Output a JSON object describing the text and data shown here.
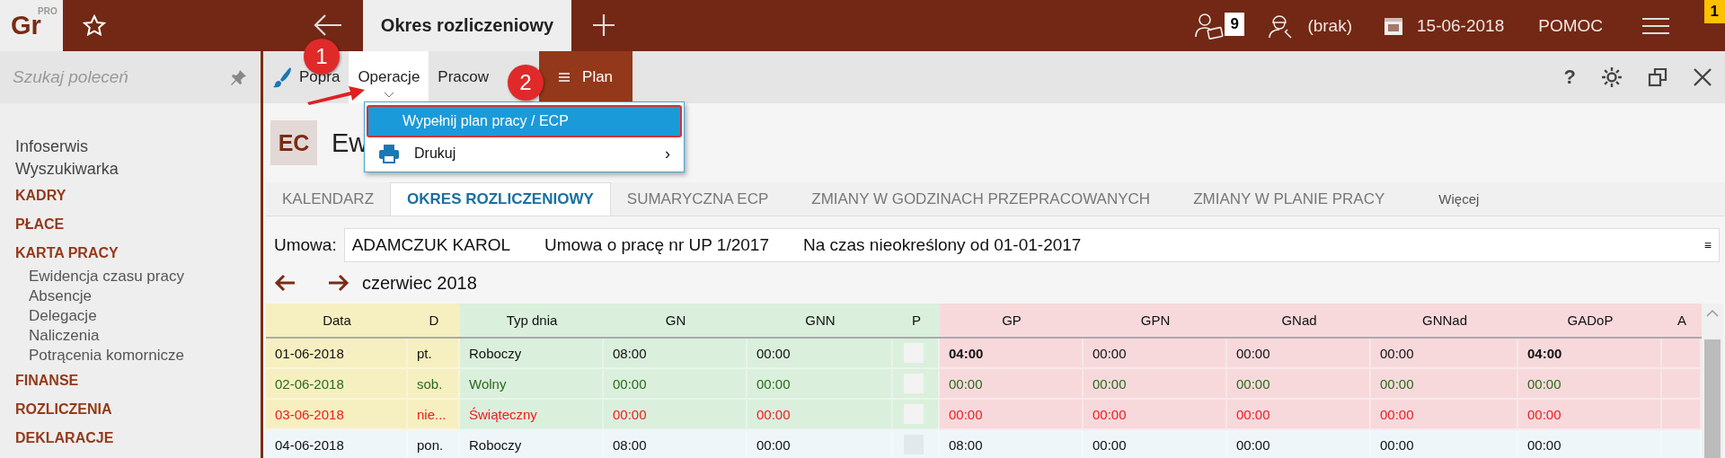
{
  "app_bar": {
    "logo": "Gr",
    "logo_badge": "PRO",
    "tab": "Okres rozliczeniowy",
    "notifications_badge": "9",
    "user": "(brak)",
    "date": "15-06-2018",
    "help": "POMOC",
    "menu_badge": "1"
  },
  "sidebar": {
    "search_placeholder": "Szukaj poleceń",
    "items": [
      {
        "label": "Infoserwis",
        "kind": "link"
      },
      {
        "label": "Wyszukiwarka",
        "kind": "link"
      },
      {
        "label": "KADRY",
        "kind": "section"
      },
      {
        "label": "PŁACE",
        "kind": "section"
      },
      {
        "label": "KARTA PRACY",
        "kind": "section",
        "children": [
          {
            "label": "Ewidencja czasu pracy"
          },
          {
            "label": "Absencje"
          },
          {
            "label": "Delegacje"
          },
          {
            "label": "Naliczenia"
          },
          {
            "label": "Potrącenia komornicze"
          }
        ]
      },
      {
        "label": "FINANSE",
        "kind": "section"
      },
      {
        "label": "ROZLICZENIA",
        "kind": "section"
      },
      {
        "label": "DEKLARACJE",
        "kind": "section"
      }
    ]
  },
  "toolbar": {
    "items": [
      {
        "label": "Popra",
        "kind": "brush",
        "expanded": false
      },
      {
        "label": "Operacje",
        "kind": "menu",
        "expanded": true
      },
      {
        "label": "Pracow",
        "kind": "plain",
        "expanded": false
      },
      {
        "label": "Plan",
        "kind": "accent",
        "expanded": false
      }
    ],
    "help": "?"
  },
  "menu": {
    "items": [
      {
        "label": "Wypełnij plan pracy / ECP",
        "kind": "plain",
        "selected": true
      },
      {
        "label": "Drukuj",
        "kind": "print",
        "selected": false,
        "submenu_arrow": "›"
      }
    ]
  },
  "annotations": [
    {
      "label": "1"
    },
    {
      "label": "2"
    }
  ],
  "document": {
    "badge": "EC",
    "title": "Ew"
  },
  "tabs": [
    {
      "label": "KALENDARZ",
      "selected": false,
      "kind": "tab"
    },
    {
      "label": "OKRES ROZLICZENIOWY",
      "selected": true,
      "kind": "tab"
    },
    {
      "label": "SUMARYCZNA ECP",
      "selected": false,
      "kind": "tab"
    },
    {
      "label": "ZMIANY W GODZINACH PRZEPRACOWANYCH",
      "selected": false,
      "kind": "tab"
    },
    {
      "label": "ZMIANY W PLANIE PRACY",
      "selected": false,
      "kind": "tab"
    },
    {
      "label": "Więcej",
      "selected": false,
      "kind": "more"
    }
  ],
  "contract": {
    "label": "Umowa:",
    "employee": "ADAMCZUK KAROL",
    "contract": "Umowa o pracę nr UP 1/2017",
    "period": "Na czas nieokreślony od 01-01-2017",
    "menu": "≡"
  },
  "period": {
    "month": "czerwiec 2018"
  },
  "table": {
    "columns": [
      {
        "label": "Data"
      },
      {
        "label": "D"
      },
      {
        "label": "Typ dnia"
      },
      {
        "label": "GN"
      },
      {
        "label": "GNN"
      },
      {
        "label": "P"
      },
      {
        "label": "GP"
      },
      {
        "label": "GPN"
      },
      {
        "label": "GNad"
      },
      {
        "label": "GNNad"
      },
      {
        "label": "GADoP"
      },
      {
        "label": "A"
      }
    ],
    "rows": [
      {
        "kind": "workday",
        "selected": false,
        "cells": [
          "01-06-2018",
          "pt.",
          "Roboczy",
          "08:00",
          "00:00",
          {
            "checked": false
          },
          {
            "text": "04:00",
            "bold": true
          },
          "00:00",
          "00:00",
          "00:00",
          {
            "text": "04:00",
            "bold": true
          }
        ]
      },
      {
        "kind": "free",
        "selected": false,
        "cells": [
          "02-06-2018",
          "sob.",
          "Wolny",
          "00:00",
          "00:00",
          {
            "checked": false
          },
          "00:00",
          "00:00",
          "00:00",
          "00:00",
          "00:00"
        ]
      },
      {
        "kind": "holiday",
        "selected": false,
        "cells": [
          "03-06-2018",
          "nie...",
          "Świąteczny",
          "00:00",
          "00:00",
          {
            "checked": false
          },
          "00:00",
          "00:00",
          "00:00",
          "00:00",
          "00:00"
        ]
      },
      {
        "kind": "workday",
        "selected": true,
        "cells": [
          "04-06-2018",
          "pon.",
          "Roboczy",
          "08:00",
          "00:00",
          {
            "checked": false
          },
          "08:00",
          "00:00",
          "00:00",
          "00:00",
          "00:00"
        ]
      }
    ]
  }
}
